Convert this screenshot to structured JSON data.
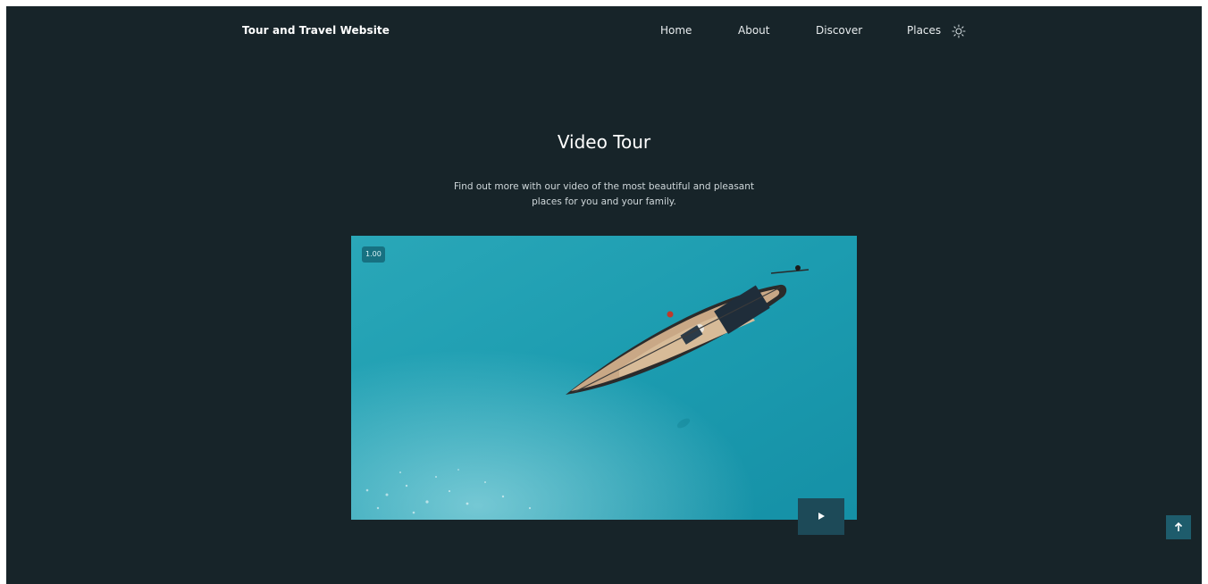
{
  "header": {
    "brand": "Tour and Travel Website",
    "nav": [
      {
        "label": "Home"
      },
      {
        "label": "About"
      },
      {
        "label": "Discover"
      },
      {
        "label": "Places"
      }
    ],
    "theme_icon": "sun-icon"
  },
  "video_section": {
    "title": "Video Tour",
    "description": "Find out more with our video of the most beautiful and pleasant places for you and your family.",
    "playback_rate": "1.00",
    "play_icon": "play-icon"
  },
  "scroll_top": {
    "icon": "arrow-up-icon"
  },
  "colors": {
    "background": "#172429",
    "water": "#1fa1b3",
    "play_button": "#1d4a58",
    "scroll_top_button": "#1e5c6c",
    "text": "#ffffff"
  }
}
